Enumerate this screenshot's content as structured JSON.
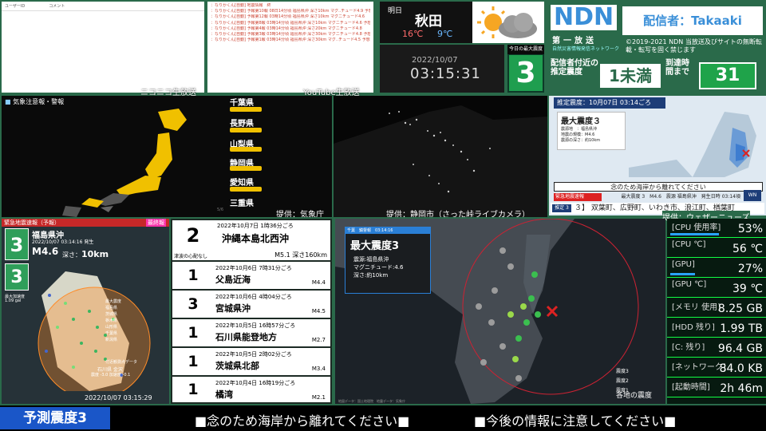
{
  "chat": {
    "niconico": {
      "col_user": "ユーザーID",
      "col_comment": "コメント",
      "label": "ニコニコ生放送"
    },
    "youtube": {
      "label": "YouTube生放送",
      "rows": [
        "：なりかくん[自動] 地震情報　終",
        "：なりかくん[自動] 予報第10報 08日14分頃 福島県沖 深さ10km マグ..チュード4.9 予想震度3",
        "：なりかくん[自動] 予報第12報 03時14分頃 福島県沖 深さ10km マグニチュード4.6",
        "：なりかくん[自動] 予報第8報 03時14分頃 福島県沖 深さ10km マグニチュード4.6 予想震度3",
        "：なりかくん[自動] 予報第4報 03時14分頃 福島県沖 深さ20km マグニチュード4.8",
        "：なりかくん[自動] 予報第3報 03時14分頃 福島県沖 深さ30km マグニチュード4.8 予想震度3",
        "：なりかくん[自動] 予報第1報 03時14分頃 福島県沖 深さ30km マグ..チュード4.5 予想震度3"
      ]
    }
  },
  "weather": {
    "label": "明日",
    "city": "秋田",
    "high": "16℃",
    "low": "9℃"
  },
  "clock": {
    "date": "2022/10/07",
    "time": "03:15:31"
  },
  "max_intensity": {
    "label": "今日の最大震度",
    "value": "3"
  },
  "ndn": {
    "logo": "NDN",
    "broadcaster": "配信者：Takaaki",
    "channel_title": "第一放送",
    "channel_sub": "自然災害情報発信ネットワーク",
    "copyright": "©2019-2021 NDN 当放送及びサイトの無断転載・転写を固く禁じます",
    "local_label": "配信者付近の推定震度",
    "local_value": "1未満",
    "arrival_label": "到達時間まで",
    "arrival_value": "31"
  },
  "warning_map": {
    "title": "気象注意報・警報",
    "prefectures": [
      "千葉県",
      "長野県",
      "山梨県",
      "静岡県",
      "愛知県",
      "三重県"
    ],
    "page": "5/6",
    "credit": "提供：気象庁"
  },
  "camera": {
    "credit": "提供：静岡市（さった峠ライブカメラ）"
  },
  "eew_panel": {
    "header": "推定震度：10月07日 03:14ごろ",
    "max_label": "最大震度３",
    "epicenter": "震源地　：福島県沖",
    "magnitude": "地震の規模：M4.6",
    "depth": "震源の深さ：約10km",
    "notice": "念のため海岸から離れてください",
    "bar_label": "緊急地震速報",
    "summary": "最大震度 3　M4.6　震源 福島県沖　発生日時 03:14頃",
    "ticker": "３】 双葉町、広野町、いわき市、浪江町、楢葉町",
    "credit": "提供：ウェザーニューズ",
    "tag": "推定 3"
  },
  "eew_map": {
    "title": "緊急地震速報（予報）",
    "final": "最終報",
    "sub": "予想最大震度",
    "region": "福島県沖",
    "time": "2022/10/07 03:14:16 発生",
    "mag": "M4.6",
    "depth_label": "深さ：",
    "depth": "10km",
    "intensity": "3",
    "accel_label": "最大加速度",
    "accel": "1.09 gal",
    "legend": [
      "最大震度",
      "福島県",
      "茨城県",
      "栃木県",
      "山形県",
      "千葉県",
      "新潟県"
    ],
    "point_label": "付近観測点データ",
    "point_name": "石川県 金沢",
    "point_val": "震度 -3.0 加速度 -0.1",
    "timestamp": "2022/10/07 03:15:29"
  },
  "quake_list": [
    {
      "date": "2022年10月7日 1時36分ごろ",
      "place": "沖縄本島北西沖",
      "int": "2",
      "mag": "M5.1 深さ160km",
      "note": "津波の心配なし"
    },
    {
      "date": "2022年10月6日 7時31分ごろ",
      "place": "父島近海",
      "int": "1",
      "mag": "M4.4"
    },
    {
      "date": "2022年10月6日 4時04分ごろ",
      "place": "宮城県沖",
      "int": "3",
      "mag": "M4.5"
    },
    {
      "date": "2022年10月5日 16時57分ごろ",
      "place": "石川県能登地方",
      "int": "1",
      "mag": "M2.7"
    },
    {
      "date": "2022年10月5日 2時02分ごろ",
      "place": "茨城県北部",
      "int": "1",
      "mag": "M3.4"
    },
    {
      "date": "2022年10月4日 16時19分ごろ",
      "place": "橘湾",
      "int": "1",
      "mag": "M2.1"
    }
  ],
  "intensity_map": {
    "tab": "千葉　鎮督報　03:14:16",
    "title": "最大震度3",
    "epicenter": "震源:福島県沖",
    "magnitude": "マグニチュード:4.6",
    "depth": "深さ:約10km",
    "legend": [
      "震度3",
      "震度2",
      "震度1"
    ],
    "caption": "各地の震度",
    "footer": "地図データ：国土地理院　地震データ：気象庁"
  },
  "stats": [
    {
      "label": "[CPU 使用率]",
      "value": "53%",
      "pct": 53
    },
    {
      "label": "[CPU ℃]",
      "value": "56 ℃"
    },
    {
      "label": "[GPU]",
      "value": "27%",
      "pct": 27
    },
    {
      "label": "[GPU ℃]",
      "value": "39 ℃"
    },
    {
      "label": "[メモリ 使用]",
      "value": "8.25 GB"
    },
    {
      "label": "[HDD 残り]",
      "value": "1.99 TB"
    },
    {
      "label": "[C: 残り]",
      "value": "96.4 GB"
    },
    {
      "label": "[ネットワーク]",
      "value": "84.0 KB"
    },
    {
      "label": "[起動時間]",
      "value": "2h 46m"
    }
  ],
  "footer": {
    "intensity": "予測震度3",
    "msg1": "■念のため海岸から離れてください■",
    "msg2": "■今後の情報に注意してください■"
  },
  "colors": {
    "bg": "#2a6a4a",
    "accent": "#1f9e4f",
    "warn": "#f0c000",
    "int3": "#2f9e5a",
    "ndn_blue": "#3a8fd8"
  }
}
